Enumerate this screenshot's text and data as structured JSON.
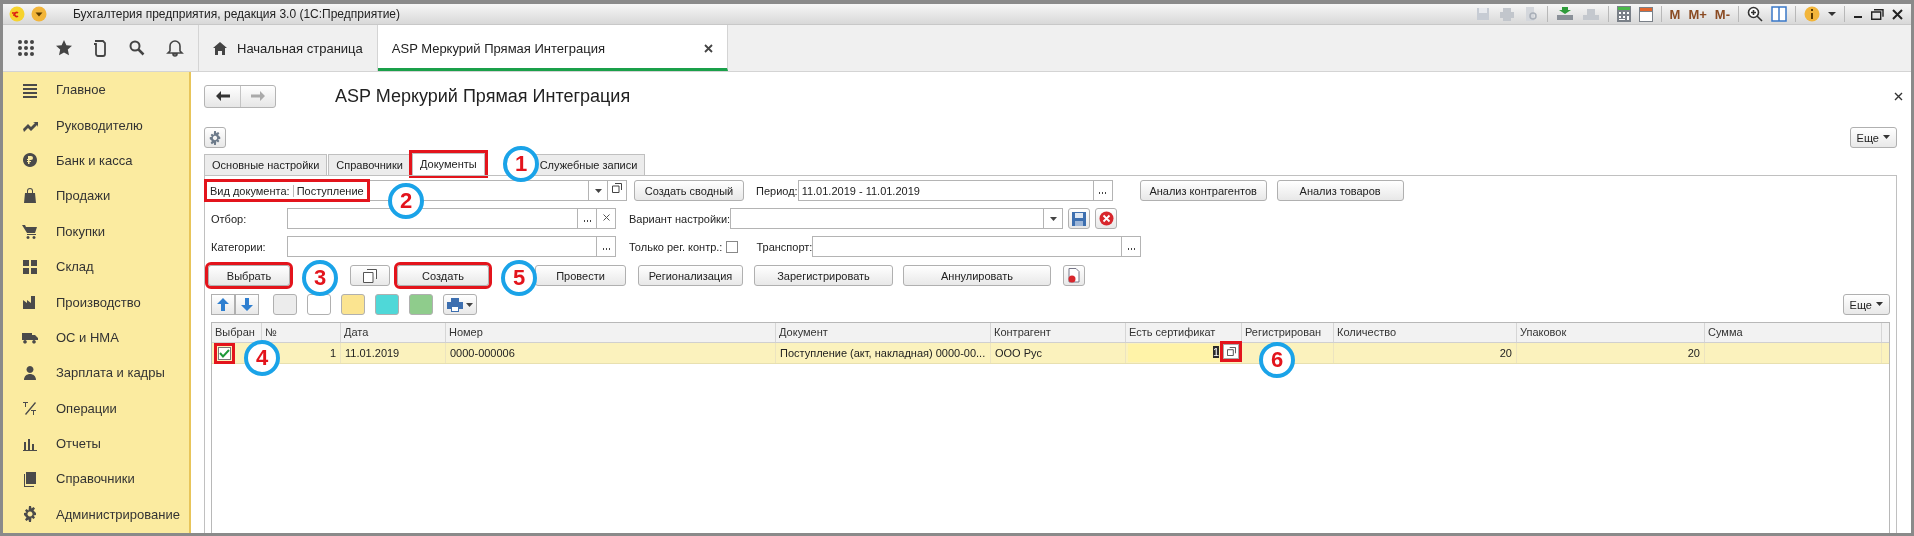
{
  "window": {
    "title": "Бухгалтерия предприятия, редакция 3.0  (1С:Предприятие)"
  },
  "toolbar": {
    "memory_buttons": [
      "M",
      "M+",
      "M-"
    ]
  },
  "app_tabs": [
    {
      "label": "Начальная страница",
      "selected": false
    },
    {
      "label": "ASP Меркурий Прямая Интеграция",
      "selected": true
    }
  ],
  "sidebar": {
    "items": [
      {
        "label": "Главное"
      },
      {
        "label": "Руководителю"
      },
      {
        "label": "Банк и касса"
      },
      {
        "label": "Продажи"
      },
      {
        "label": "Покупки"
      },
      {
        "label": "Склад"
      },
      {
        "label": "Производство"
      },
      {
        "label": "ОС и НМА"
      },
      {
        "label": "Зарплата и кадры"
      },
      {
        "label": "Операции"
      },
      {
        "label": "Отчеты"
      },
      {
        "label": "Справочники"
      },
      {
        "label": "Администрирование"
      }
    ]
  },
  "form": {
    "title": "ASP Меркурий Прямая Интеграция",
    "more_button": "Еще",
    "tabs": [
      {
        "label": "Основные настройки",
        "selected": false,
        "highlighted": false
      },
      {
        "label": "Справочники",
        "selected": false,
        "highlighted": false
      },
      {
        "label": "Документы",
        "selected": true,
        "highlighted": true
      },
      {
        "label": "Служебные записи",
        "selected": false,
        "highlighted": false
      }
    ],
    "document_type": {
      "label": "Вид документа:",
      "value": "Поступление",
      "highlighted": true
    },
    "create_summary_button": "Создать сводный",
    "period": {
      "label": "Период:",
      "value": "11.01.2019 - 11.01.2019"
    },
    "analysis_buttons": [
      "Анализ контрагентов",
      "Анализ товаров"
    ],
    "filter": {
      "label": "Отбор:"
    },
    "variant": {
      "label": "Вариант настройки:"
    },
    "categories": {
      "label": "Категории:"
    },
    "only_registered": {
      "label": "Только рег. контр.:",
      "checked": false
    },
    "transport": {
      "label": "Транспорт:"
    },
    "actions": [
      {
        "kind": "text",
        "label": "Выбрать",
        "highlighted": true
      },
      {
        "kind": "copy",
        "highlighted": false
      },
      {
        "kind": "text",
        "label": "Создать",
        "highlighted": true
      },
      {
        "kind": "text",
        "label": "Провести",
        "highlighted": false
      },
      {
        "kind": "text",
        "label": "Регионализация",
        "highlighted": false
      },
      {
        "kind": "text",
        "label": "Зарегистрировать",
        "highlighted": false
      },
      {
        "kind": "text",
        "label": "Аннулировать",
        "highlighted": false
      },
      {
        "kind": "cancel",
        "highlighted": false
      }
    ],
    "row_colors": [
      {
        "color": "#ececec"
      },
      {
        "color": "#ffffff"
      },
      {
        "color": "#fbe490"
      },
      {
        "color": "#4fd8d8"
      },
      {
        "color": "#8fcc8c"
      }
    ],
    "table_more_button": "Еще",
    "table": {
      "columns": [
        {
          "label": "Выбран"
        },
        {
          "label": "№"
        },
        {
          "label": "Дата"
        },
        {
          "label": "Номер"
        },
        {
          "label": "Документ"
        },
        {
          "label": "Контрагент"
        },
        {
          "label": "Есть сертификат"
        },
        {
          "label": "Регистрирован"
        },
        {
          "label": "Количество"
        },
        {
          "label": "Упаковок"
        },
        {
          "label": "Сумма"
        }
      ],
      "rows": [
        {
          "selected": true,
          "checked": true,
          "highlighted": true,
          "number": "1",
          "date": "11.01.2019",
          "doc_number": "0000-000006",
          "document": "Поступление (акт, накладная) 0000-00...",
          "counterparty": "ООО Рус",
          "certificate": "1",
          "certificate_button_highlighted": true,
          "quantity": "20",
          "packages": "20"
        }
      ]
    }
  },
  "callouts": [
    {
      "label": "1"
    },
    {
      "label": "2"
    },
    {
      "label": "3"
    },
    {
      "label": "4"
    },
    {
      "label": "5"
    },
    {
      "label": "6"
    }
  ]
}
